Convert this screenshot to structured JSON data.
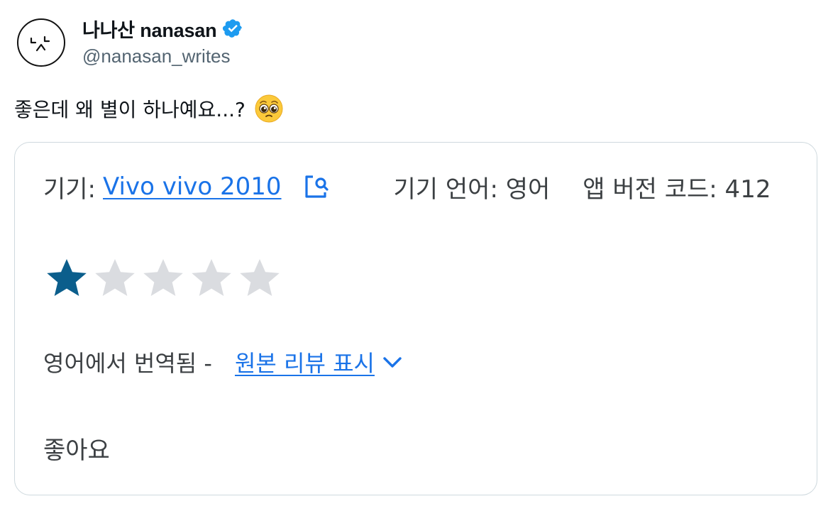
{
  "user": {
    "display_name": "나나산 nanasan",
    "handle": "@nanasan_writes",
    "avatar_icon": "smiley-face-icon",
    "verified_icon": "verified-badge-icon",
    "verified_color": "#1d9bf0"
  },
  "tweet": {
    "text": "좋은데 왜 별이 하나예요...?",
    "emoji": "pleading-face-emoji"
  },
  "review_card": {
    "device_label": "기기:",
    "device_name": "Vivo vivo 2010",
    "device_icon": "external-link-icon",
    "language": "기기 언어: 영어",
    "app_version": "앱 버전 코드: 412",
    "rating": 1,
    "rating_max": 5,
    "star_filled_color": "#0b5e8c",
    "star_empty_color": "#dadce0",
    "translated_from": "영어에서 번역됨 -",
    "show_original": "원본 리뷰 표시",
    "review_text": "좋아요",
    "link_color": "#1a73e8"
  }
}
